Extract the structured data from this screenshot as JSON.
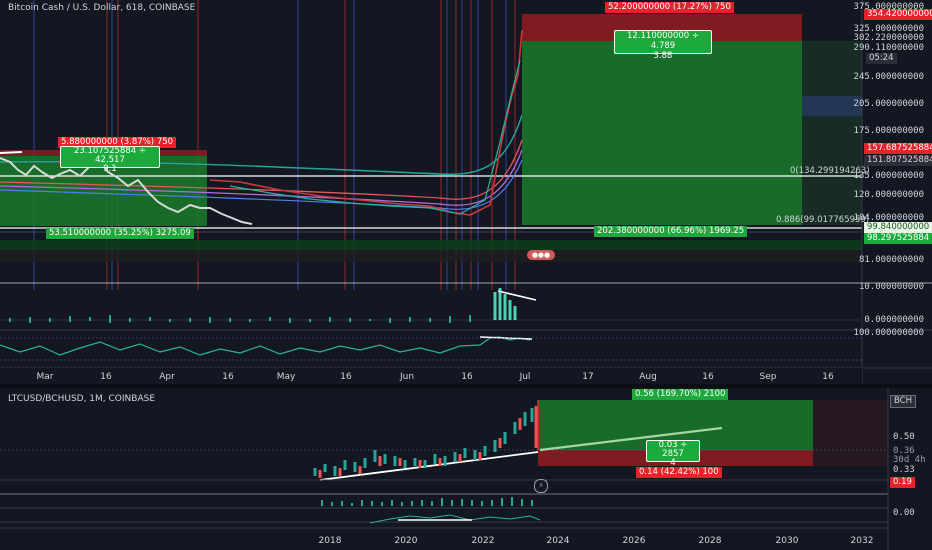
{
  "top_chart": {
    "title": "Bitcoin Cash / U.S. Dollar, 618, COINBASE",
    "price_labels": [
      "375.000000000",
      "325.000000000",
      "302.220000000",
      "290.110000000",
      "245.000000000",
      "205.000000000",
      "175.000000000",
      "135.000000000",
      "120.000000000",
      "104.000000000",
      "81.000000000"
    ],
    "tag_354": "354.420000000",
    "tag_countdown": "05:24",
    "tag_157": "157.687525884",
    "tag_151": "151.807525884",
    "tag_99": "99.840000000",
    "tag_98": "98.297525884",
    "fib_0": "0(134.299194263)",
    "fib_886": "0.886(99.017765959)",
    "pos1_target": "52.200000000 (17.27%) 750",
    "pos1_rr": "12.110000000 ÷ 4.789",
    "pos1_rr2": "3.88",
    "pos1_stop": "202.380000000 (66.96%) 1969.25",
    "pos2_target": "5.880000000 (3.87%) 750",
    "pos2_rr": "23.107525884 ÷ 42.517",
    "pos2_rr2": "9.1",
    "pos2_stop": "53.510000000 (35.25%) 3275.09",
    "osc_labels": [
      "10.000000000",
      "0.000000000",
      "100.000000000"
    ],
    "xaxis": [
      "Mar",
      "16",
      "Apr",
      "16",
      "May",
      "16",
      "Jun",
      "16",
      "Jul",
      "17",
      "Aug",
      "16",
      "Sep",
      "16"
    ]
  },
  "bottom_chart": {
    "title": "LTCUSD/BCHUSD, 1M, COINBASE",
    "symbol_tag": "BCH",
    "price_labels": [
      "0.50",
      "0.33",
      "0.00"
    ],
    "tag_036": "0.36",
    "tag_30d": "30d 4h",
    "tag_019": "0.19",
    "pos_target": "0.56 (169.70%) 2100",
    "pos_rr": "0.03 ÷ 2857",
    "pos_rr2": "4",
    "pos_stop": "0.14 (42.42%) 100",
    "xaxis": [
      "2018",
      "2020",
      "2022",
      "2024",
      "2026",
      "2028",
      "2030",
      "2032"
    ]
  },
  "colors": {
    "up": "#26a69a",
    "down": "#ef5350",
    "bg": "#131722",
    "green_zone": "#1e7a2e",
    "red_zone": "#8e1c22"
  }
}
